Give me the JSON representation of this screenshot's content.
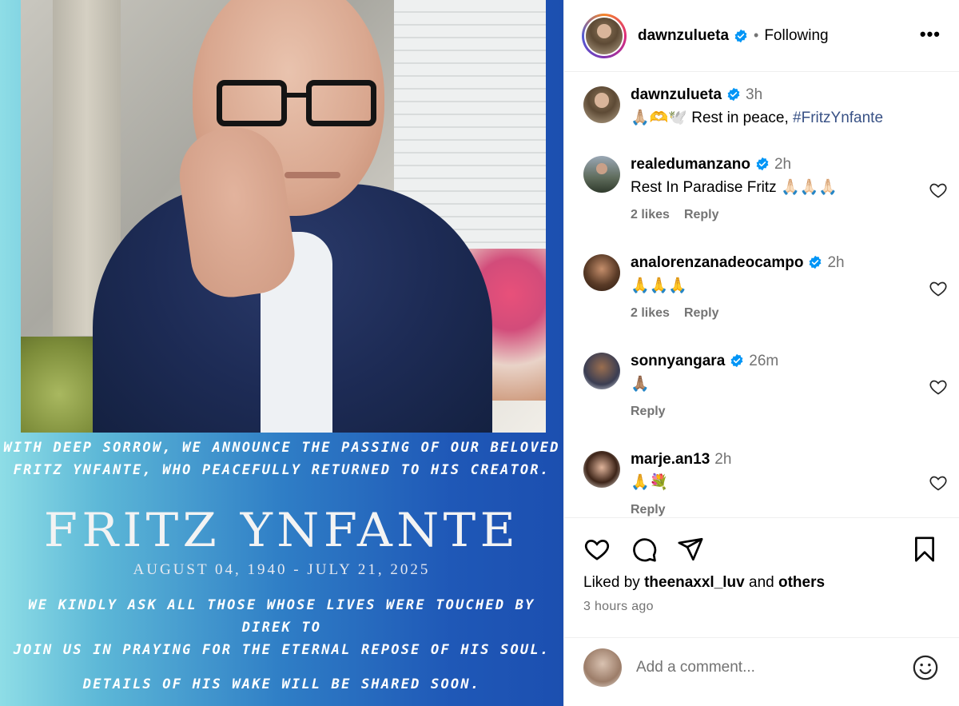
{
  "post": {
    "image_text": {
      "line1": "WITH DEEP SORROW, WE ANNOUNCE THE PASSING OF OUR BELOVED",
      "line2": "FRITZ YNFANTE, WHO PEACEFULLY RETURNED TO HIS CREATOR.",
      "name": "FRITZ YNFANTE",
      "dates": "AUGUST 04, 1940 - JULY 21, 2025",
      "line3": "WE KINDLY ASK ALL THOSE WHOSE LIVES WERE TOUCHED BY DIREK TO",
      "line4": "JOIN US IN PRAYING FOR THE ETERNAL REPOSE OF HIS SOUL.",
      "line5": "DETAILS OF HIS WAKE WILL BE SHARED SOON."
    }
  },
  "header": {
    "username": "dawnzulueta",
    "separator": "•",
    "follow_state": "Following",
    "more_label": "•••"
  },
  "caption": {
    "username": "dawnzulueta",
    "time": "3h",
    "emojis": "🙏🏼🫶🕊️",
    "text": "Rest in peace,",
    "hashtag": "#FritzYnfante"
  },
  "comments": [
    {
      "username": "realedumanzano",
      "time": "2h",
      "text": "Rest In Paradise Fritz 🙏🏻🙏🏻🙏🏻",
      "likes": "2 likes",
      "reply": "Reply"
    },
    {
      "username": "analorenzanadeocampo",
      "time": "2h",
      "text": "🙏🙏🙏",
      "likes": "2 likes",
      "reply": "Reply"
    },
    {
      "username": "sonnyangara",
      "time": "26m",
      "text": "🙏🏽",
      "likes": "",
      "reply": "Reply"
    },
    {
      "username": "marje.an13",
      "time": "2h",
      "text": "🙏💐",
      "likes": "",
      "reply": "Reply"
    }
  ],
  "actions": {
    "liked_prefix": "Liked by",
    "liked_user": "theenaxxl_luv",
    "liked_and": "and",
    "liked_others": "others",
    "posted_ago": "3 hours ago"
  },
  "composer": {
    "placeholder": "Add a comment..."
  },
  "colors": {
    "verified": "#0095f6",
    "hashtag": "#385185",
    "muted": "#737373"
  }
}
